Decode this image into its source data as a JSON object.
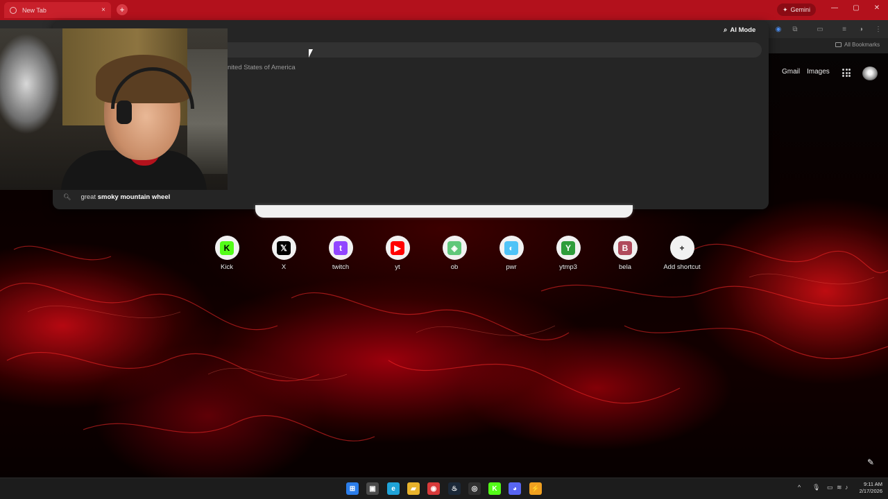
{
  "browser": {
    "tab": {
      "title": "New Tab",
      "close_glyph": "×"
    },
    "new_tab_glyph": "+",
    "gemini_label": "Gemini",
    "window_controls": {
      "minimize": "—",
      "maximize": "▢",
      "close": "✕"
    },
    "bookmarks": {
      "all_bookmarks": "All Bookmarks"
    }
  },
  "omnibox": {
    "ai_mode_label": "AI Mode",
    "location_text": "nited States of America",
    "suggestion": {
      "prefix": "great ",
      "bold": "smoky mountain wheel"
    }
  },
  "ntp": {
    "header_links": {
      "gmail": "Gmail",
      "images": "Images"
    },
    "shortcuts": [
      {
        "label": "Kick",
        "glyph": "K",
        "color": "#53fc18",
        "fg": "#000000"
      },
      {
        "label": "X",
        "glyph": "𝕏",
        "color": "#000000",
        "fg": "#ffffff"
      },
      {
        "label": "twitch",
        "glyph": "t",
        "color": "#9146ff",
        "fg": "#ffffff"
      },
      {
        "label": "yt",
        "glyph": "▶",
        "color": "#ff0000",
        "fg": "#ffffff"
      },
      {
        "label": "ob",
        "glyph": "◈",
        "color": "#5fc87a",
        "fg": "#ffffff"
      },
      {
        "label": "pwr",
        "glyph": "◐",
        "color": "#4fc3f7",
        "fg": "#ffffff"
      },
      {
        "label": "ytmp3",
        "glyph": "Y",
        "color": "#2e9d3b",
        "fg": "#ffffff"
      },
      {
        "label": "bela",
        "glyph": "B",
        "color": "#b04a5c",
        "fg": "#ffffff"
      },
      {
        "label": "Add shortcut",
        "glyph": "+",
        "color": "#f1f1f1",
        "fg": "#222222"
      }
    ],
    "edit_glyph": "✎"
  },
  "webcam": {
    "shirt_logo": "K"
  },
  "taskbar": {
    "apps": [
      {
        "name": "start-icon",
        "glyph": "⊞",
        "color": "#2b7de9"
      },
      {
        "name": "task-view-icon",
        "glyph": "▣",
        "color": "#4a4a4a"
      },
      {
        "name": "edge-icon",
        "glyph": "e",
        "color": "#1fa3d8"
      },
      {
        "name": "file-explorer-icon",
        "glyph": "▰",
        "color": "#e9b32c"
      },
      {
        "name": "chrome-icon",
        "glyph": "◉",
        "color": "#d83a3a"
      },
      {
        "name": "steam-icon",
        "glyph": "♨",
        "color": "#1b2838"
      },
      {
        "name": "obs-icon",
        "glyph": "◎",
        "color": "#303030"
      },
      {
        "name": "kick-app-icon",
        "glyph": "K",
        "color": "#53fc18"
      },
      {
        "name": "discord-icon",
        "glyph": "◕",
        "color": "#5865f2"
      },
      {
        "name": "app-icon",
        "glyph": "⚡",
        "color": "#f0a020"
      }
    ],
    "tray": {
      "chevron": "^",
      "mic": "🎙",
      "network": "▭",
      "wifi": "≋",
      "volume": "♪"
    },
    "clock": {
      "time": "9:11 AM",
      "date": "2/17/2026"
    }
  }
}
